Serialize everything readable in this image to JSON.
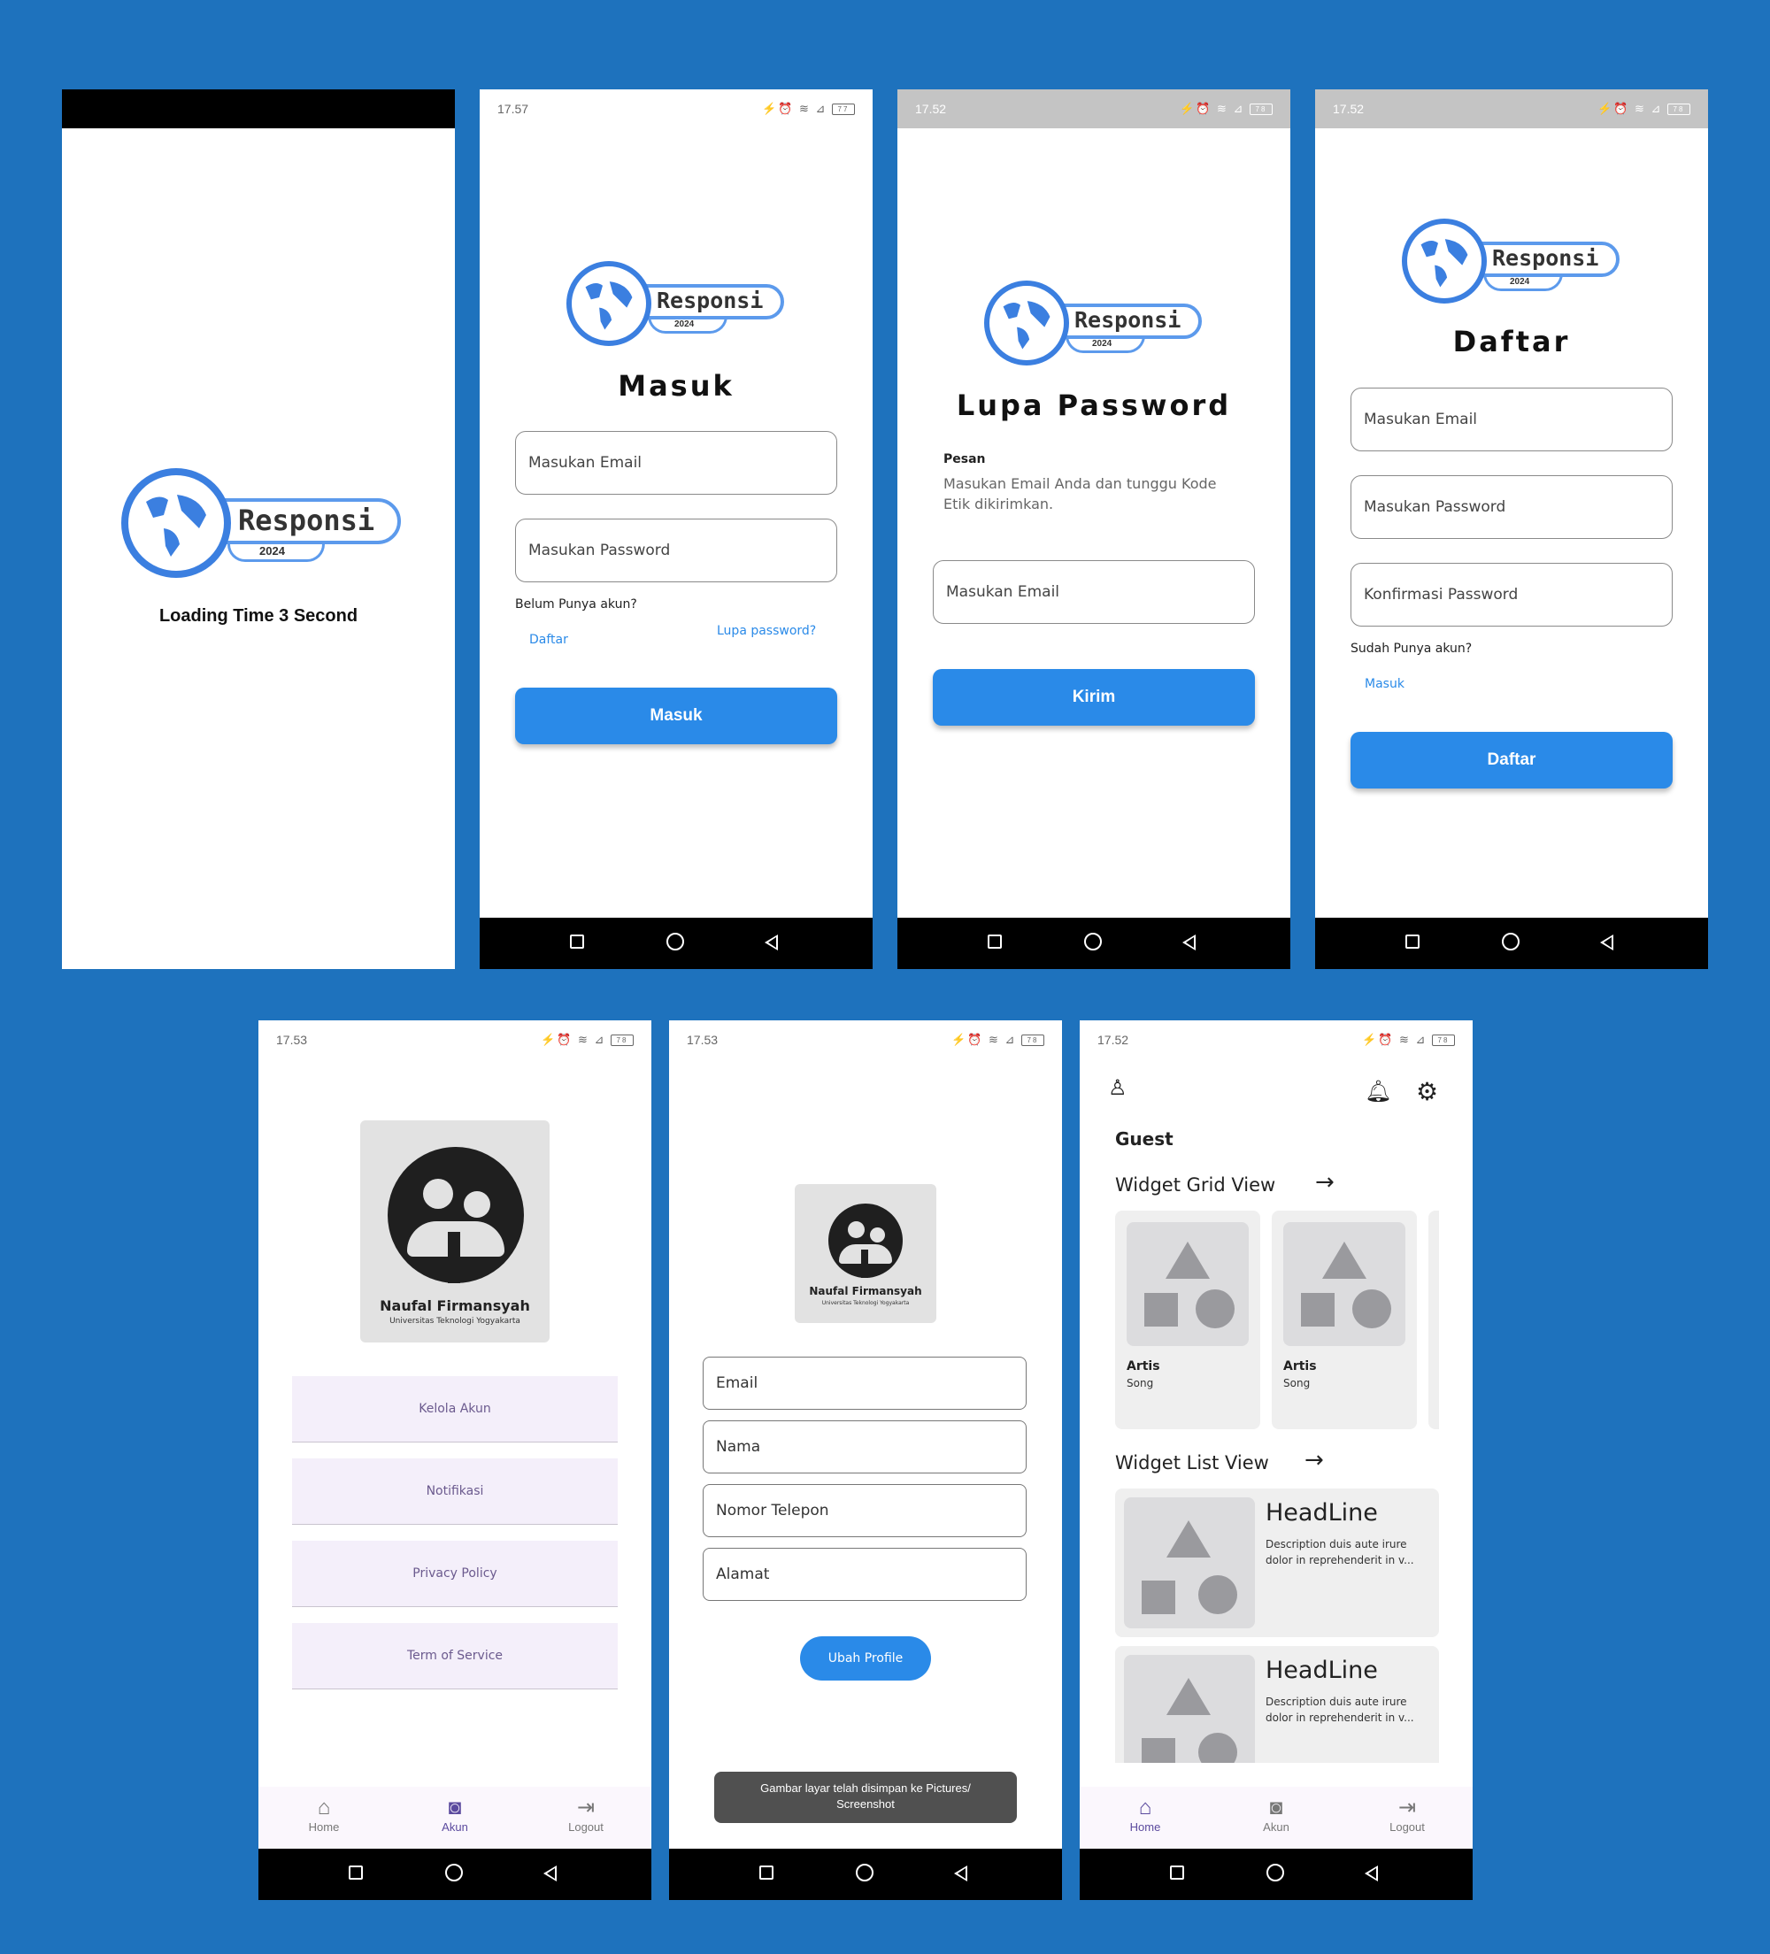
{
  "splash": {
    "logo_word": "Responsi",
    "logo_year": "2024",
    "caption": "Loading Time 3 Second"
  },
  "login": {
    "time": "17.57",
    "logo_word": "Responsi",
    "logo_year": "2024",
    "title": "Masuk",
    "email_placeholder": "Masukan Email",
    "password_placeholder": "Masukan Password",
    "no_account": "Belum Punya akun?",
    "register_link": "Daftar",
    "forgot_link": "Lupa password?",
    "submit": "Masuk"
  },
  "forgot": {
    "time": "17.52",
    "logo_word": "Responsi",
    "logo_year": "2024",
    "title": "Lupa Password",
    "msg_label": "Pesan",
    "msg_text": "Masukan Email Anda dan tunggu Kode Etik dikirimkan.",
    "email_placeholder": "Masukan Email",
    "submit": "Kirim"
  },
  "register": {
    "time": "17.52",
    "logo_word": "Responsi",
    "logo_year": "2024",
    "title": "Daftar",
    "email_placeholder": "Masukan Email",
    "password_placeholder": "Masukan Password",
    "confirm_placeholder": "Konfirmasi Password",
    "have_account": "Sudah Punya akun?",
    "login_link": "Masuk",
    "submit": "Daftar"
  },
  "account": {
    "time": "17.53",
    "name": "Naufal Firmansyah",
    "university": "Universitas Teknologi Yogyakarta",
    "menu": [
      "Kelola Akun",
      "Notifikasi",
      "Privacy Policy",
      "Term of Service"
    ],
    "nav": {
      "home": "Home",
      "account": "Akun",
      "logout": "Logout"
    }
  },
  "edit_profile": {
    "time": "17.53",
    "name": "Naufal Firmansyah",
    "university": "Universitas Teknologi Yogyakarta",
    "fields": [
      "Email",
      "Nama",
      "Nomor Telepon",
      "Alamat"
    ],
    "submit": "Ubah Profile",
    "toast": "Gambar layar telah disimpan ke  Pictures/ Screenshot"
  },
  "home": {
    "time": "17.52",
    "greeting": "Guest",
    "grid_title": "Widget Grid View",
    "grid_items": [
      {
        "title": "Artis",
        "sub": "Song"
      },
      {
        "title": "Artis",
        "sub": "Song"
      }
    ],
    "list_title": "Widget List View",
    "list_items": [
      {
        "headline": "HeadLine",
        "desc": "Description duis aute irure dolor in reprehenderit in v..."
      },
      {
        "headline": "HeadLine",
        "desc": "Description duis aute irure dolor in reprehenderit in v..."
      }
    ],
    "nav": {
      "home": "Home",
      "account": "Akun",
      "logout": "Logout"
    }
  },
  "colors": {
    "background": "#1e72bd",
    "primary": "#2a8ae8",
    "logo_blue": "#3b7fe0",
    "menu_bg": "#f4effa",
    "nav_active": "#5b4a9e"
  }
}
